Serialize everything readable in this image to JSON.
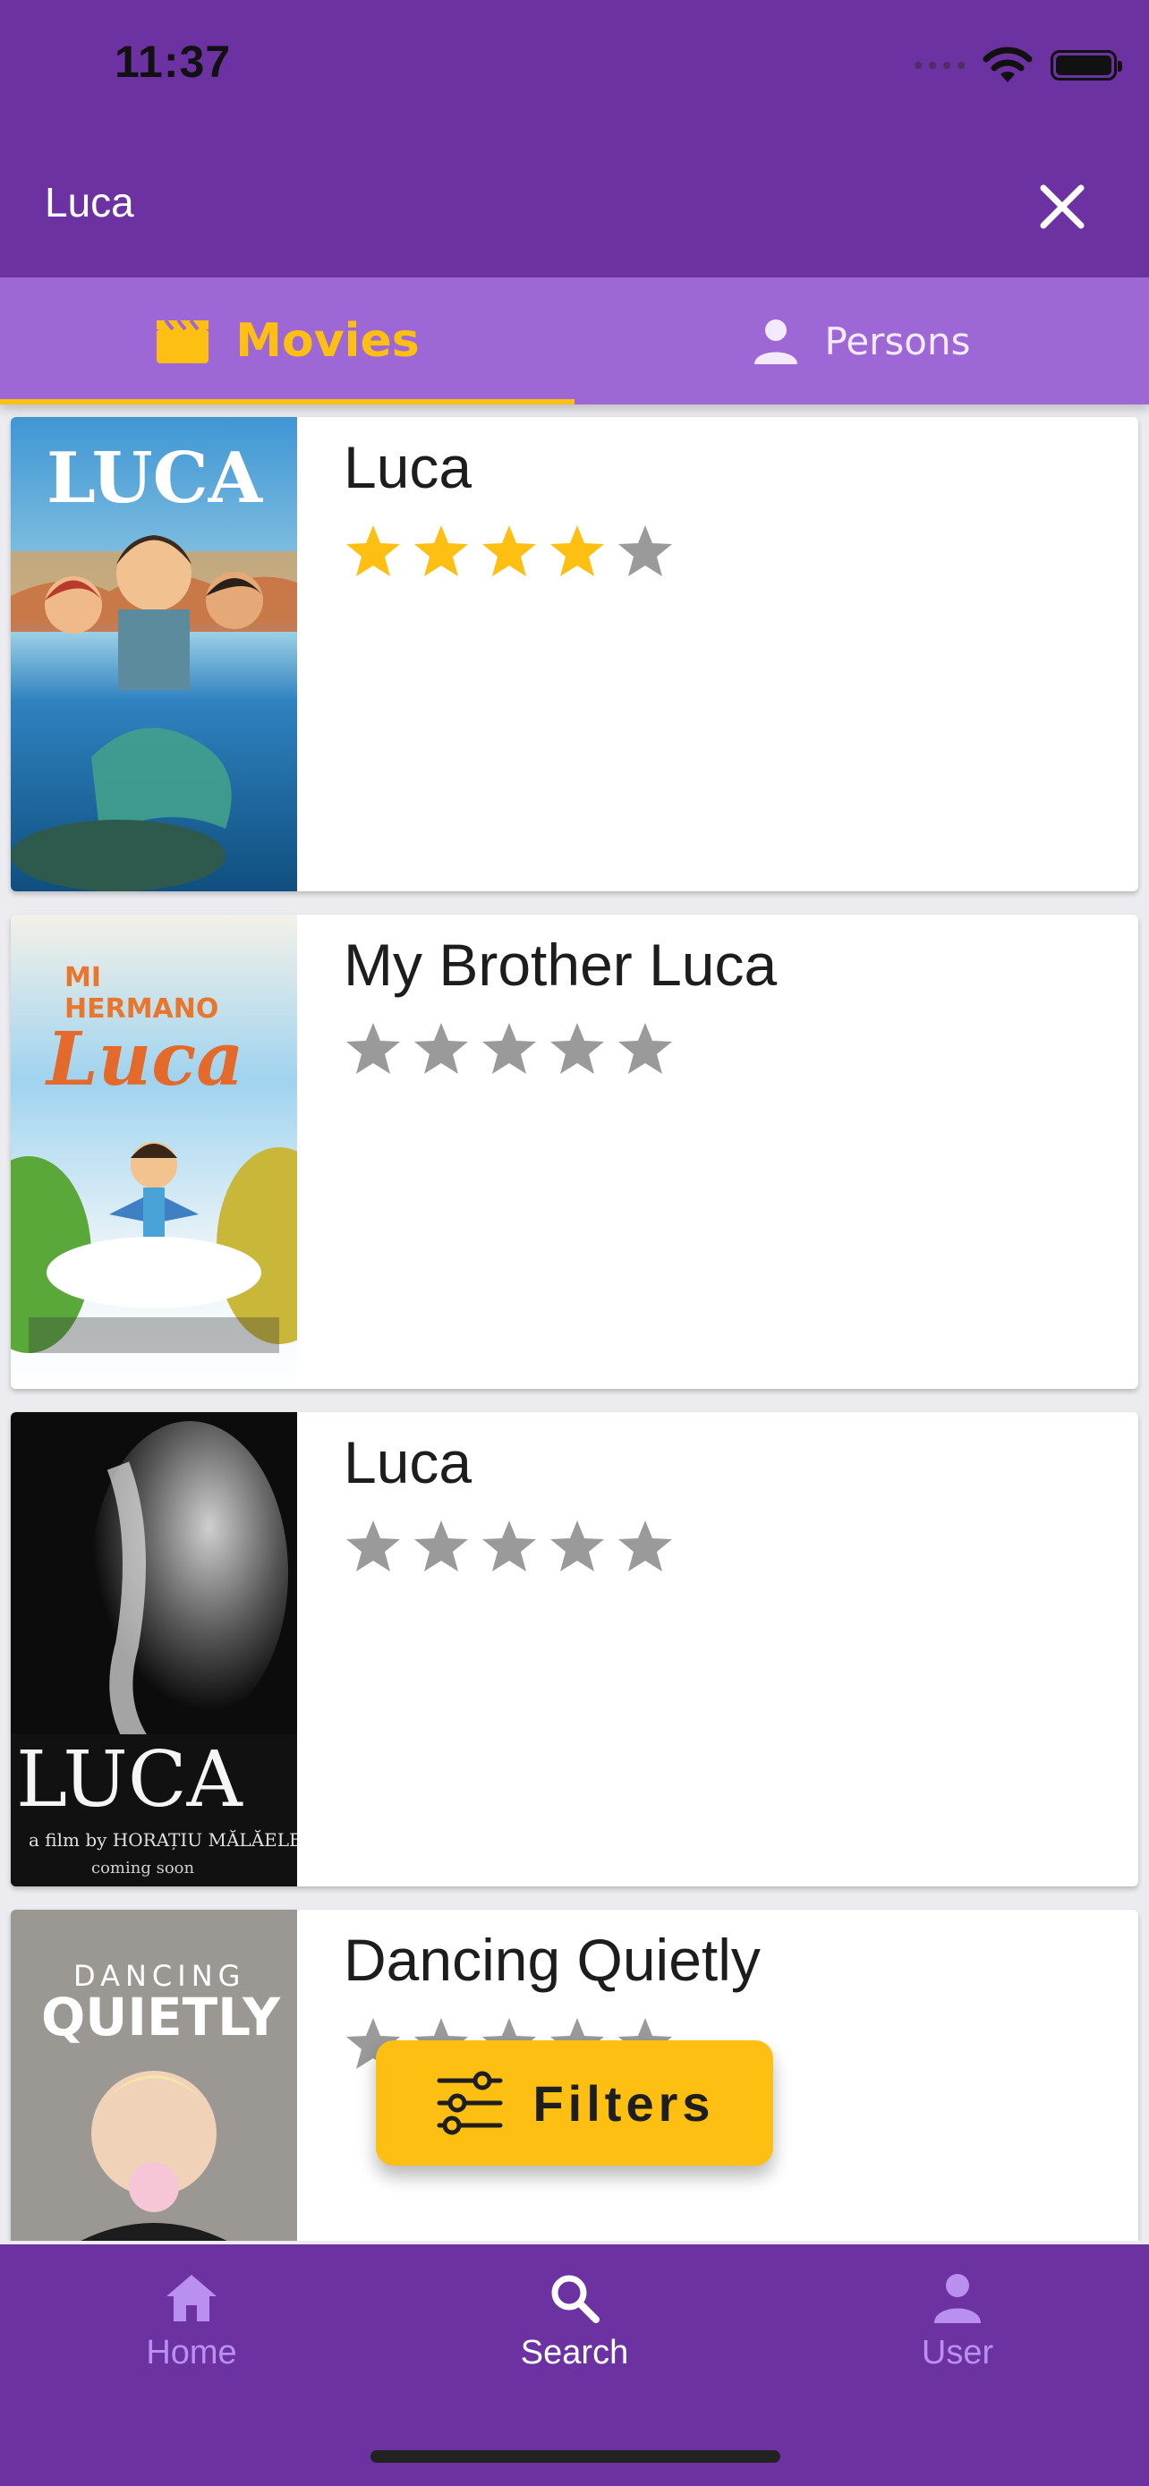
{
  "status_bar": {
    "time": "11:37"
  },
  "search": {
    "value": "Luca"
  },
  "tabs": [
    {
      "label": "Movies",
      "icon": "clapperboard-icon",
      "active": true
    },
    {
      "label": "Persons",
      "icon": "person-icon",
      "active": false
    }
  ],
  "results": [
    {
      "title": "Luca",
      "rating": 4,
      "max_rating": 5,
      "poster_text": "LUCA"
    },
    {
      "title": "My Brother Luca",
      "rating": 0,
      "max_rating": 5,
      "poster_text": "MI HERMANO Luca"
    },
    {
      "title": "Luca",
      "rating": 0,
      "max_rating": 5,
      "poster_text": "LUCA"
    },
    {
      "title": "Dancing Quietly",
      "rating": 0,
      "max_rating": 5,
      "poster_text": "DANCING QUIETLY"
    }
  ],
  "filters_button": {
    "label": "Filters"
  },
  "bottom_nav": [
    {
      "label": "Home",
      "icon": "home-icon",
      "active": false
    },
    {
      "label": "Search",
      "icon": "search-icon",
      "active": true
    },
    {
      "label": "User",
      "icon": "user-icon",
      "active": false
    }
  ],
  "colors": {
    "primary": "#6c32a2",
    "tab_bar": "#9e67d6",
    "accent": "#fdbf12",
    "star_empty": "#9a9a9a"
  }
}
